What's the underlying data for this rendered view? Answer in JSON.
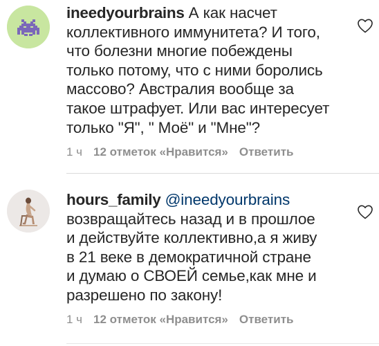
{
  "comments": [
    {
      "username": "ineedyourbrains",
      "mention": "",
      "text": "А как насчет\nколлективного иммунитета? И того,\nчто болезни многие побеждены\nтолько потому, что с ними боролись\nмассово? Австралия вообще за\nтакое штрафует. Или вас интересует\nтолько \"Я\", \" Моё\" и \"Мне\"?",
      "time": "1 ч",
      "likes": "12 отметок «Нравится»",
      "reply": "Ответить",
      "avatar_icon": "purple-space-invader-icon"
    },
    {
      "username": "hours_family",
      "mention": "@ineedyourbrains",
      "text": "возвращайтесь назад и в прошлое\nи действуйте коллективно,а я живу\nв 21 веке в демократичной стране\nи думаю о СВОЕЙ семье,как мне и\nразрешено по закону!",
      "time": "1 ч",
      "likes": "12 отметок «Нравится»",
      "reply": "Ответить",
      "avatar_icon": "user-photo-avatar"
    }
  ],
  "colors": {
    "text": "#262626",
    "meta": "#8e8e8e",
    "mention": "#00376b",
    "avatar1_bg": "#c8e6a0",
    "invader": "#7b68b9"
  }
}
